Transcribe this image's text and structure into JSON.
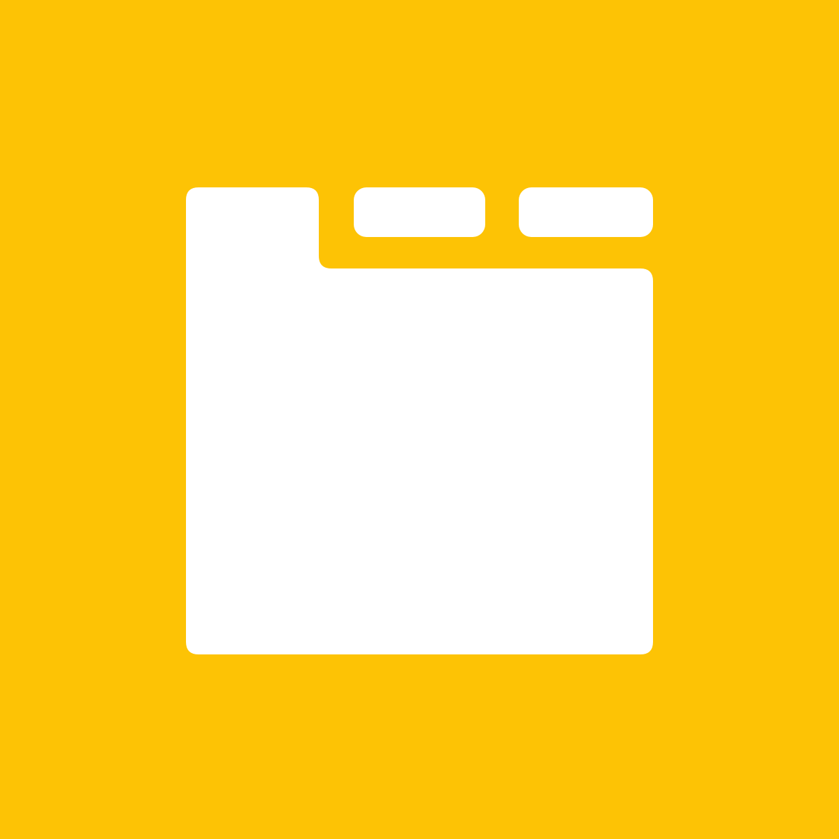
{
  "icon": {
    "name": "tabbed-window-icon",
    "background_color": "#FDC305",
    "foreground_color": "#FFFFFF",
    "tab_count": 3,
    "active_tab": 1
  }
}
